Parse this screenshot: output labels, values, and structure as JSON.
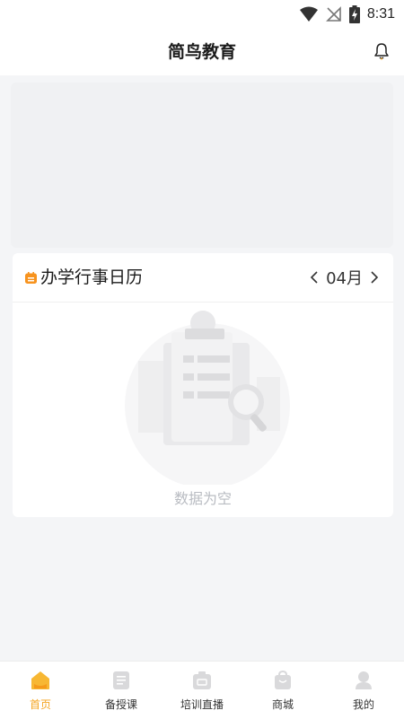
{
  "status_bar": {
    "time": "8:31"
  },
  "header": {
    "title": "简鸟教育"
  },
  "calendar": {
    "title": "办学行事日历",
    "month": "04月",
    "empty_text": "数据为空"
  },
  "tabbar": {
    "tabs": [
      {
        "label": "首页",
        "active": true,
        "icon": "home-icon"
      },
      {
        "label": "备授课",
        "active": false,
        "icon": "document-icon"
      },
      {
        "label": "培训直播",
        "active": false,
        "icon": "live-tv-icon"
      },
      {
        "label": "商城",
        "active": false,
        "icon": "shopping-bag-icon"
      },
      {
        "label": "我的",
        "active": false,
        "icon": "profile-icon"
      }
    ]
  },
  "colors": {
    "accent": "#f5a623",
    "background": "#f4f5f7",
    "muted_text": "#b9bcc2"
  }
}
